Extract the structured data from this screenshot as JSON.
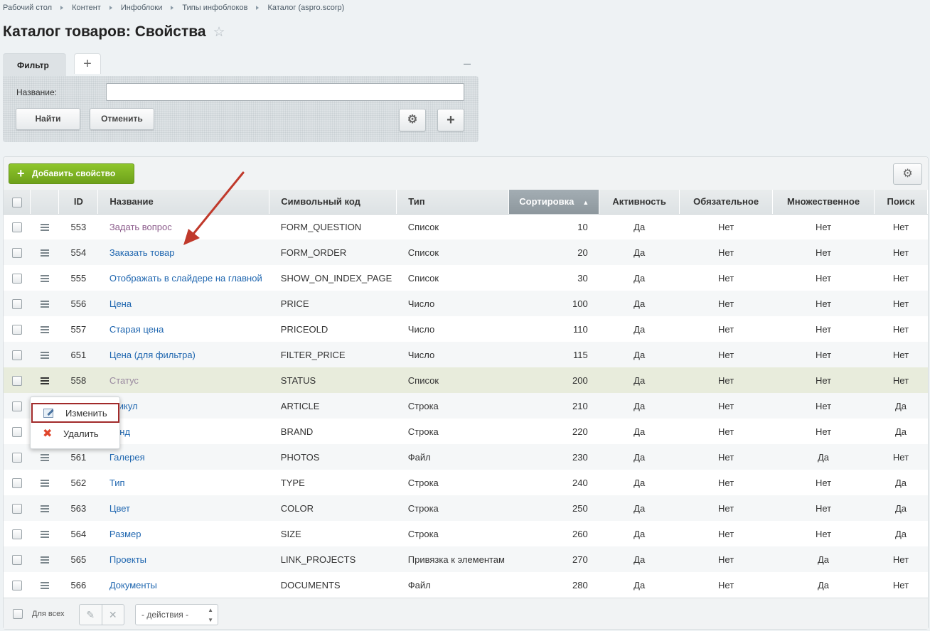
{
  "breadcrumbs": [
    "Рабочий стол",
    "Контент",
    "Инфоблоки",
    "Типы инфоблоков",
    "Каталог (aspro.scorp)"
  ],
  "page": {
    "title": "Каталог товаров: Свойства",
    "star_icon": "star-icon"
  },
  "filter": {
    "tab_label": "Фильтр",
    "add_tab": "+",
    "collapse": "–",
    "name_label": "Название:",
    "name_value": "",
    "find_button": "Найти",
    "cancel_button": "Отменить",
    "settings_icon": "⚙",
    "add_button": "+"
  },
  "toolbar": {
    "add_property": "Добавить свойство",
    "settings_icon": "⚙"
  },
  "columns": {
    "id": "ID",
    "name": "Название",
    "code": "Символьный код",
    "type": "Тип",
    "sort": "Сортировка",
    "active": "Активность",
    "required": "Обязательное",
    "multiple": "Множественное",
    "search": "Поиск"
  },
  "rows": [
    {
      "id": "553",
      "name": "Задать вопрос",
      "code": "FORM_QUESTION",
      "type": "Список",
      "sort": "10",
      "active": "Да",
      "required": "Нет",
      "multiple": "Нет",
      "search": "Нет"
    },
    {
      "id": "554",
      "name": "Заказать товар",
      "code": "FORM_ORDER",
      "type": "Список",
      "sort": "20",
      "active": "Да",
      "required": "Нет",
      "multiple": "Нет",
      "search": "Нет"
    },
    {
      "id": "555",
      "name": "Отображать в слайдере на главной",
      "code": "SHOW_ON_INDEX_PAGE",
      "type": "Список",
      "sort": "30",
      "active": "Да",
      "required": "Нет",
      "multiple": "Нет",
      "search": "Нет"
    },
    {
      "id": "556",
      "name": "Цена",
      "code": "PRICE",
      "type": "Число",
      "sort": "100",
      "active": "Да",
      "required": "Нет",
      "multiple": "Нет",
      "search": "Нет"
    },
    {
      "id": "557",
      "name": "Старая цена",
      "code": "PRICEOLD",
      "type": "Число",
      "sort": "110",
      "active": "Да",
      "required": "Нет",
      "multiple": "Нет",
      "search": "Нет"
    },
    {
      "id": "651",
      "name": "Цена (для фильтра)",
      "code": "FILTER_PRICE",
      "type": "Число",
      "sort": "115",
      "active": "Да",
      "required": "Нет",
      "multiple": "Нет",
      "search": "Нет"
    },
    {
      "id": "558",
      "name": "Статус",
      "code": "STATUS",
      "type": "Список",
      "sort": "200",
      "active": "Да",
      "required": "Нет",
      "multiple": "Нет",
      "search": "Нет"
    },
    {
      "id": "",
      "name": "ртикул",
      "code": "ARTICLE",
      "type": "Строка",
      "sort": "210",
      "active": "Да",
      "required": "Нет",
      "multiple": "Нет",
      "search": "Да"
    },
    {
      "id": "",
      "name": "ренд",
      "code": "BRAND",
      "type": "Строка",
      "sort": "220",
      "active": "Да",
      "required": "Нет",
      "multiple": "Нет",
      "search": "Да"
    },
    {
      "id": "561",
      "name": "Галерея",
      "code": "PHOTOS",
      "type": "Файл",
      "sort": "230",
      "active": "Да",
      "required": "Нет",
      "multiple": "Да",
      "search": "Нет"
    },
    {
      "id": "562",
      "name": "Тип",
      "code": "TYPE",
      "type": "Строка",
      "sort": "240",
      "active": "Да",
      "required": "Нет",
      "multiple": "Нет",
      "search": "Да"
    },
    {
      "id": "563",
      "name": "Цвет",
      "code": "COLOR",
      "type": "Строка",
      "sort": "250",
      "active": "Да",
      "required": "Нет",
      "multiple": "Нет",
      "search": "Да"
    },
    {
      "id": "564",
      "name": "Размер",
      "code": "SIZE",
      "type": "Строка",
      "sort": "260",
      "active": "Да",
      "required": "Нет",
      "multiple": "Нет",
      "search": "Да"
    },
    {
      "id": "565",
      "name": "Проекты",
      "code": "LINK_PROJECTS",
      "type": "Привязка к элементам",
      "sort": "270",
      "active": "Да",
      "required": "Нет",
      "multiple": "Да",
      "search": "Нет"
    },
    {
      "id": "566",
      "name": "Документы",
      "code": "DOCUMENTS",
      "type": "Файл",
      "sort": "280",
      "active": "Да",
      "required": "Нет",
      "multiple": "Да",
      "search": "Нет"
    }
  ],
  "context_menu": {
    "edit": "Изменить",
    "delete": "Удалить"
  },
  "footer": {
    "for_all": "Для всех",
    "actions_select": "- действия -"
  },
  "colors": {
    "accent_green": "#7ab221",
    "link": "#2067b0",
    "annotation_arrow": "#c0392b",
    "highlight_row": "#e8ecdc"
  }
}
